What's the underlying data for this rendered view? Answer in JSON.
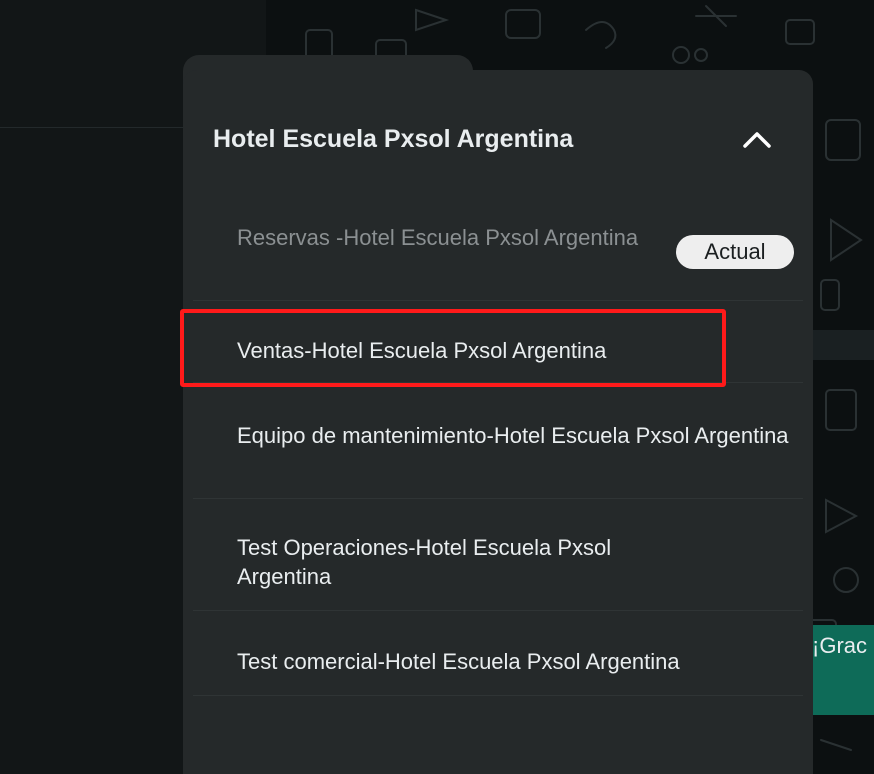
{
  "menu": {
    "title": "Hotel Escuela Pxsol Argentina",
    "collapse_icon": "chevron-up-icon",
    "current_badge": "Actual",
    "items": [
      {
        "label": "Reservas -Hotel Escuela Pxsol Argentina",
        "state": "current"
      },
      {
        "label": "Ventas-Hotel Escuela Pxsol Argentina",
        "state": "highlighted"
      },
      {
        "label": "Equipo de mantenimiento-Hotel Escuela Pxsol Argentina",
        "state": "normal"
      },
      {
        "label": "Test Operaciones-Hotel Escuela Pxsol Argentina",
        "state": "normal"
      },
      {
        "label": "Test comercial-Hotel Escuela Pxsol Argentina",
        "state": "normal"
      }
    ]
  },
  "background": {
    "message_preview": "¡Grac"
  },
  "colors": {
    "popup_bg": "#25292a",
    "highlight": "#ff1a1a",
    "accent_green": "#0e6b58"
  }
}
